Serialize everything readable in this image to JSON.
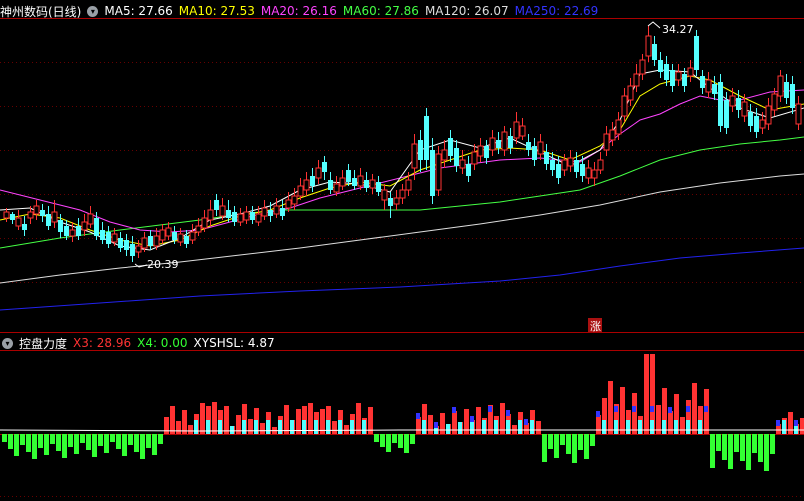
{
  "main_panel": {
    "stock_title": "神州数码(日线)",
    "ma_items": [
      {
        "label": "MA5: 27.66",
        "color": "#ffffff"
      },
      {
        "label": "MA10: 27.53",
        "color": "#ffff00"
      },
      {
        "label": "MA20: 26.16",
        "color": "#ff44ff"
      },
      {
        "label": "MA60: 27.86",
        "color": "#44ff44"
      },
      {
        "label": "MA120: 26.07",
        "color": "#dddddd"
      },
      {
        "label": "MA250: 22.69",
        "color": "#3333ff"
      }
    ],
    "high_label": "34.27",
    "low_label": "20.39",
    "rise_badge": "涨"
  },
  "indicator_panel": {
    "title": "控盘力度",
    "items": [
      {
        "label": "X3: 28.96",
        "color": "#ff3333"
      },
      {
        "label": "X4: 0.00",
        "color": "#33ff33"
      },
      {
        "label": "XYSHSL: 4.87",
        "color": "#ffffff"
      }
    ]
  },
  "colors": {
    "up": "#ff3333",
    "down": "#54ffff",
    "grid": "#8b0000",
    "ma250": "#2222ee"
  }
}
